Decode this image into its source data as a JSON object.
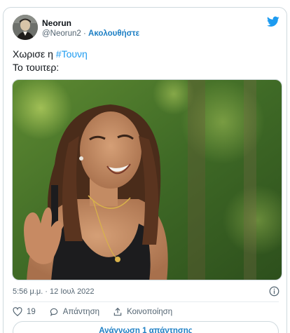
{
  "author": {
    "name": "Neorun",
    "handle": "@Neorun2",
    "separator": "·",
    "follow_label": "Ακολουθήστε"
  },
  "tweet": {
    "line1_prefix": "Χωρισε η ",
    "hashtag": "#Τουνη",
    "line2": "Το τουιτερ:"
  },
  "timestamp": "5:56 μ.μ. · 12 Ιουλ 2022",
  "actions": {
    "likes_count": "19",
    "reply_label": "Απάντηση",
    "share_label": "Κοινοποίηση"
  },
  "read_replies_label": "Ανάγνωση 1 απάντησης",
  "colors": {
    "link": "#1d7fc4",
    "hashtag": "#1d9bf0",
    "twitter_blue": "#1d9bf0",
    "muted": "#536471"
  },
  "icons": [
    "twitter-logo-icon",
    "info-icon",
    "heart-icon",
    "reply-icon",
    "share-icon"
  ]
}
